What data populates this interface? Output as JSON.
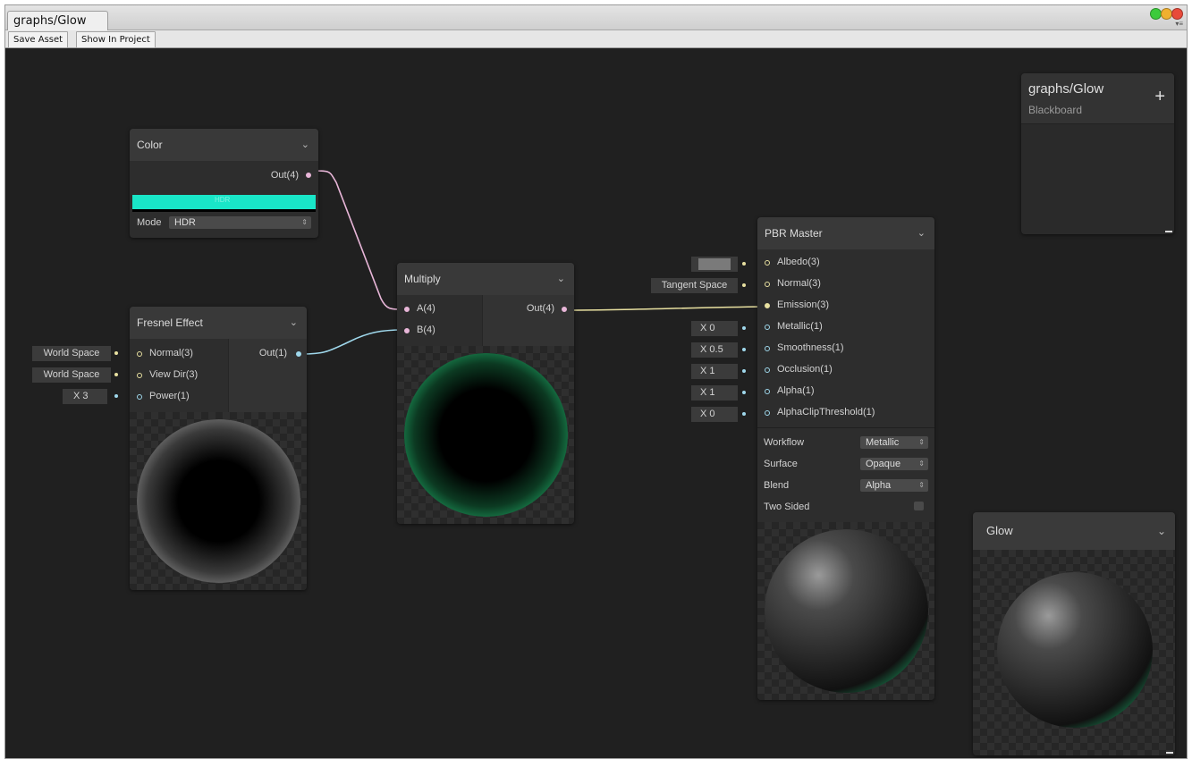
{
  "window": {
    "tab_title": "graphs/Glow"
  },
  "toolbar": {
    "save_label": "Save Asset",
    "show_label": "Show In Project"
  },
  "blackboard": {
    "title": "graphs/Glow",
    "subtitle": "Blackboard",
    "add_symbol": "+"
  },
  "color_node": {
    "title": "Color",
    "out": "Out(4)",
    "swatch_text": "HDR",
    "mode_label": "Mode",
    "mode_value": "HDR",
    "swatch_color": "#19e6c8"
  },
  "fresnel": {
    "title": "Fresnel Effect",
    "normal": "Normal(3)",
    "viewdir": "View Dir(3)",
    "power": "Power(1)",
    "out": "Out(1)",
    "normal_value": "World Space",
    "viewdir_value": "World Space",
    "power_value": "X 3"
  },
  "multiply": {
    "title": "Multiply",
    "a": "A(4)",
    "b": "B(4)",
    "out": "Out(4)"
  },
  "pbr": {
    "title": "PBR Master",
    "inputs": [
      "Albedo(3)",
      "Normal(3)",
      "Emission(3)",
      "Metallic(1)",
      "Smoothness(1)",
      "Occlusion(1)",
      "Alpha(1)",
      "AlphaClipThreshold(1)"
    ],
    "normal_value": "Tangent Space",
    "metallic_value": "X 0",
    "smoothness_value": "X 0.5",
    "occlusion_value": "X 1",
    "alpha_value": "X 1",
    "clip_value": "X 0",
    "workflow_label": "Workflow",
    "workflow_value": "Metallic",
    "surface_label": "Surface",
    "surface_value": "Opaque",
    "blend_label": "Blend",
    "blend_value": "Alpha",
    "twosided_label": "Two Sided"
  },
  "glow_preview": {
    "title": "Glow"
  },
  "colors": {
    "accent_green": "#2fe68e",
    "wire_pink": "#e8b6d8",
    "wire_blue": "#9fd8ec",
    "wire_yellow": "#e8e0a0"
  }
}
